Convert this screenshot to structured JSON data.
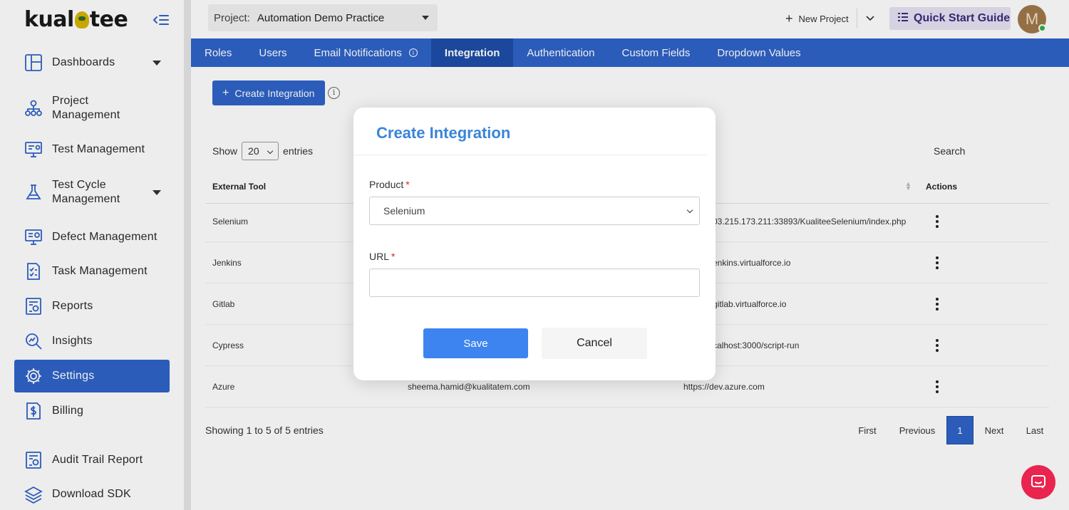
{
  "app": {
    "logo_text": "kualitee",
    "colors": {
      "brand_blue": "#2f64c9",
      "tab_active": "#1e4ea8",
      "modal_title": "#3a84d8",
      "save_button": "#3d84f0",
      "required_star": "#e02020",
      "chat_button": "#e8244f"
    }
  },
  "sidebar": {
    "collapse_icon": "collapse-menu-icon",
    "items": [
      {
        "label": "Dashboards",
        "icon": "dashboard-icon",
        "has_caret": true
      },
      {
        "label": "Project\nManagement",
        "icon": "project-tree-icon"
      },
      {
        "label": "Test Management",
        "icon": "test-monitor-icon"
      },
      {
        "label": "Test Cycle\nManagement",
        "icon": "flask-icon",
        "has_caret": true
      },
      {
        "label": "Defect Management",
        "icon": "bug-monitor-icon"
      },
      {
        "label": "Task Management",
        "icon": "checklist-icon"
      },
      {
        "label": "Reports",
        "icon": "report-icon"
      },
      {
        "label": "Insights",
        "icon": "insights-magnifier-icon"
      },
      {
        "label": "Settings",
        "icon": "gear-icon",
        "active": true
      },
      {
        "label": "Billing",
        "icon": "billing-dollar-icon"
      },
      {
        "label": "Audit Trail Report",
        "icon": "audit-report-icon"
      },
      {
        "label": "Download SDK",
        "icon": "layers-icon"
      }
    ]
  },
  "topbar": {
    "project_label": "Project:",
    "project_value": "Automation Demo Practice",
    "new_project": "New Project",
    "quick_start": "Quick Start Guide",
    "avatar_initial": "M"
  },
  "tabs": [
    {
      "label": "Roles"
    },
    {
      "label": "Users"
    },
    {
      "label": "Email Notifications",
      "info": true
    },
    {
      "label": "Integration",
      "active": true
    },
    {
      "label": "Authentication"
    },
    {
      "label": "Custom Fields"
    },
    {
      "label": "Dropdown Values"
    }
  ],
  "page": {
    "create_button": "Create Integration",
    "show_label": "Show",
    "entries_value": "20",
    "entries_label": "entries",
    "search_label": "Search",
    "columns": [
      "External Tool",
      "Actions"
    ],
    "rows": [
      {
        "tool": "Selenium",
        "user": "",
        "url": "03.215.173.211:33893/KualiteeSelenium/index.php"
      },
      {
        "tool": "Jenkins",
        "user": "",
        "url": "enkins.virtualforce.io"
      },
      {
        "tool": "Gitlab",
        "user": "",
        "url": "gitlab.virtualforce.io"
      },
      {
        "tool": "Cypress",
        "user": "",
        "url": "calhost:3000/script-run"
      },
      {
        "tool": "Azure",
        "user": "sheema.hamid@kualitatem.com",
        "url": "https://dev.azure.com"
      }
    ],
    "showing_text": "Showing 1 to 5 of 5 entries",
    "pagination": {
      "first": "First",
      "previous": "Previous",
      "current": "1",
      "next": "Next",
      "last": "Last"
    }
  },
  "modal": {
    "title": "Create Integration",
    "product_label": "Product",
    "product_value": "Selenium",
    "url_label": "URL",
    "url_value": "",
    "required_mark": "*",
    "save": "Save",
    "cancel": "Cancel"
  }
}
